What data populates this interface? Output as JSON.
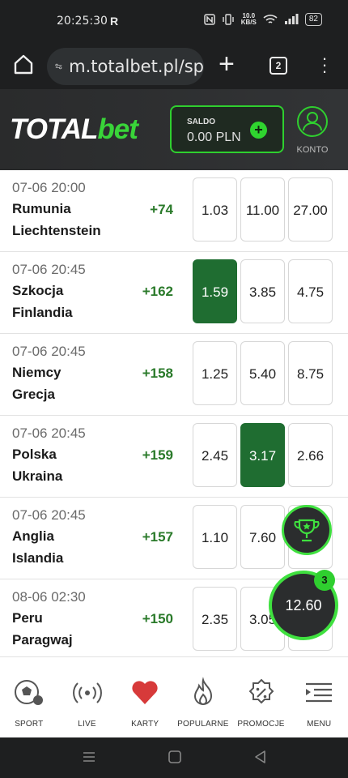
{
  "status": {
    "time": "20:25:30",
    "carrier_glyph": "R",
    "net_speed_top": "10.0",
    "net_speed_bottom": "KB/S",
    "battery": "82"
  },
  "browser": {
    "url": "m.totalbet.pl/sp",
    "tab_count": "2"
  },
  "header": {
    "logo_left": "TOTAL",
    "logo_right": "bet",
    "saldo_label": "SALDO",
    "saldo_value": "0.00 PLN",
    "konto_label": "KONTO"
  },
  "colors": {
    "accent": "#2fcf2f",
    "selected_odd": "#1f6d31",
    "more_markets": "#2a7a2a"
  },
  "matches": [
    {
      "date": "07-06 20:00",
      "team1": "Rumunia",
      "team2": "Liechtenstein",
      "more": "+74",
      "odds": [
        "1.03",
        "11.00",
        "27.00"
      ],
      "selected": -1
    },
    {
      "date": "07-06 20:45",
      "team1": "Szkocja",
      "team2": "Finlandia",
      "more": "+162",
      "odds": [
        "1.59",
        "3.85",
        "4.75"
      ],
      "selected": 0
    },
    {
      "date": "07-06 20:45",
      "team1": "Niemcy",
      "team2": "Grecja",
      "more": "+158",
      "odds": [
        "1.25",
        "5.40",
        "8.75"
      ],
      "selected": -1
    },
    {
      "date": "07-06 20:45",
      "team1": "Polska",
      "team2": "Ukraina",
      "more": "+159",
      "odds": [
        "2.45",
        "3.17",
        "2.66"
      ],
      "selected": 1
    },
    {
      "date": "07-06 20:45",
      "team1": "Anglia",
      "team2": "Islandia",
      "more": "+157",
      "odds": [
        "1.10",
        "7.60",
        ""
      ],
      "selected": -1
    },
    {
      "date": "08-06 02:30",
      "team1": "Peru",
      "team2": "Paragwaj",
      "more": "+150",
      "odds": [
        "2.35",
        "3.05",
        ""
      ],
      "selected": -1
    }
  ],
  "betslip": {
    "total": "12.60",
    "count": "3"
  },
  "nav": [
    {
      "label": "SPORT",
      "icon": "soccer-ball-icon"
    },
    {
      "label": "LIVE",
      "icon": "live-broadcast-icon"
    },
    {
      "label": "KARTY",
      "icon": "heart-icon"
    },
    {
      "label": "POPULARNE",
      "icon": "flame-icon"
    },
    {
      "label": "PROMOCJE",
      "icon": "promo-badge-icon"
    },
    {
      "label": "MENU",
      "icon": "menu-icon"
    }
  ]
}
